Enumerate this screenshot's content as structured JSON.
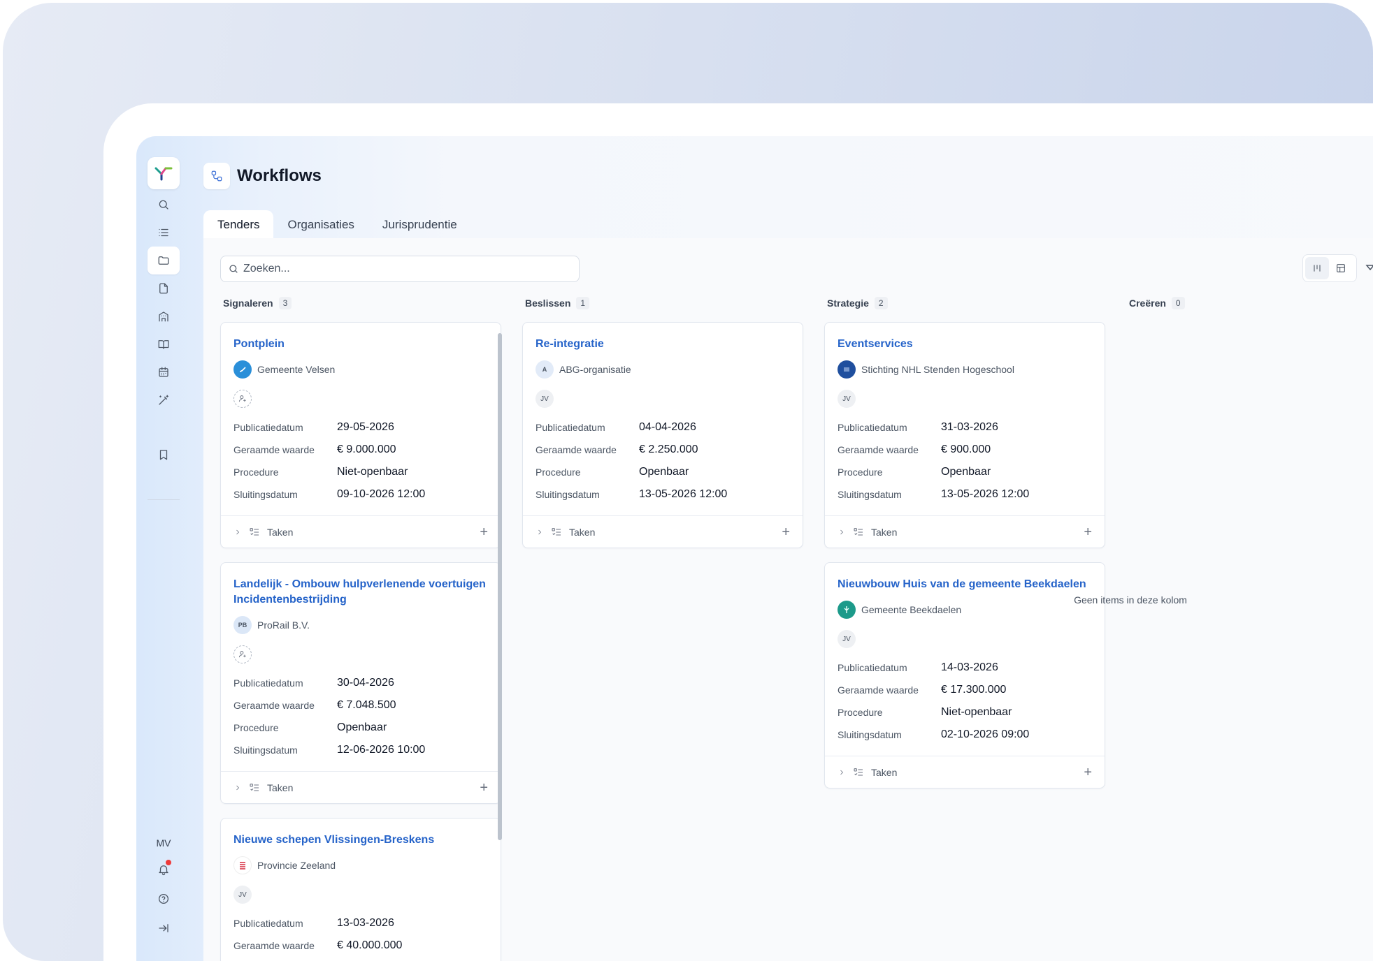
{
  "app": {
    "title": "Workflows",
    "tabs": [
      {
        "label": "Tenders",
        "active": true
      },
      {
        "label": "Organisaties",
        "active": false
      },
      {
        "label": "Jurisprudentie",
        "active": false
      }
    ],
    "search": {
      "placeholder": "Zoeken..."
    },
    "user_initials": "MV",
    "accent_color": "#2563c9"
  },
  "columns": [
    {
      "name": "Signaleren",
      "count": "3"
    },
    {
      "name": "Beslissen",
      "count": "1"
    },
    {
      "name": "Strategie",
      "count": "2"
    },
    {
      "name": "Creëren",
      "count": "0",
      "empty_text": "Geen items in deze kolom"
    }
  ],
  "labels": {
    "pub": "Publicatiedatum",
    "value": "Geraamde waarde",
    "procedure": "Procedure",
    "close": "Sluitingsdatum",
    "tasks": "Taken"
  },
  "cards": [
    {
      "title": "Pontplein",
      "org": "Gemeente Velsen",
      "assignee": "",
      "pub": "29-05-2026",
      "value": "€ 9.000.000",
      "procedure": "Niet-openbaar",
      "close": "09-10-2026 12:00"
    },
    {
      "title": "Landelijk - Ombouw hulpverlenende voertuigen Incidentenbestrijding",
      "org": "ProRail B.V.",
      "org_initials": "PB",
      "assignee": "",
      "pub": "30-04-2026",
      "value": "€ 7.048.500",
      "procedure": "Openbaar",
      "close": "12-06-2026 10:00"
    },
    {
      "title": "Nieuwe schepen Vlissingen-Breskens",
      "org": "Provincie Zeeland",
      "assignee": "JV",
      "pub": "13-03-2026",
      "value": "€ 40.000.000"
    },
    {
      "title": "Re-integratie",
      "org": "ABG-organisatie",
      "org_initials": "A",
      "assignee": "JV",
      "pub": "04-04-2026",
      "value": "€ 2.250.000",
      "procedure": "Openbaar",
      "close": "13-05-2026 12:00"
    },
    {
      "title": "Eventservices",
      "org": "Stichting NHL Stenden Hogeschool",
      "assignee": "JV",
      "pub": "31-03-2026",
      "value": "€ 900.000",
      "procedure": "Openbaar",
      "close": "13-05-2026 12:00"
    },
    {
      "title": "Nieuwbouw Huis van de gemeente Beekdaelen",
      "org": "Gemeente Beekdaelen",
      "assignee": "JV",
      "pub": "14-03-2026",
      "value": "€ 17.300.000",
      "procedure": "Niet-openbaar",
      "close": "02-10-2026 09:00"
    }
  ]
}
